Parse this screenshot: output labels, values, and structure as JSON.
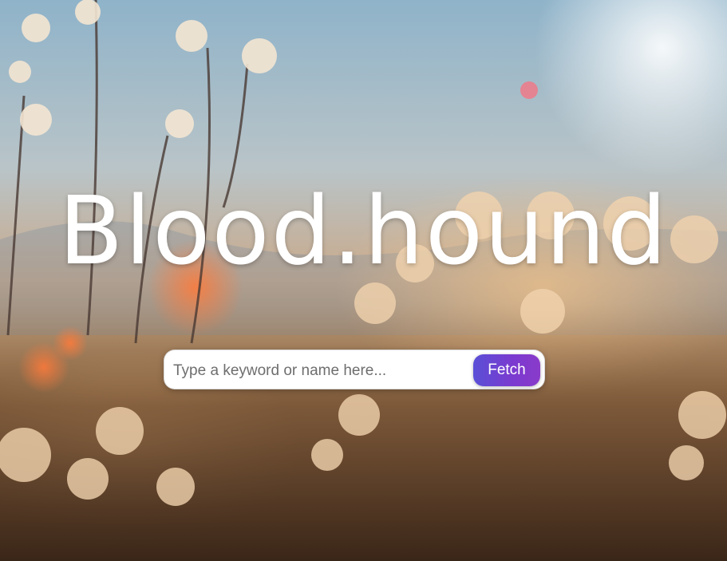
{
  "app": {
    "title": "Blood.hound"
  },
  "search": {
    "placeholder": "Type a keyword or name here...",
    "value": "",
    "button_label": "Fetch"
  },
  "colors": {
    "accent": "#6a44d2",
    "title_text": "#ffffff"
  }
}
